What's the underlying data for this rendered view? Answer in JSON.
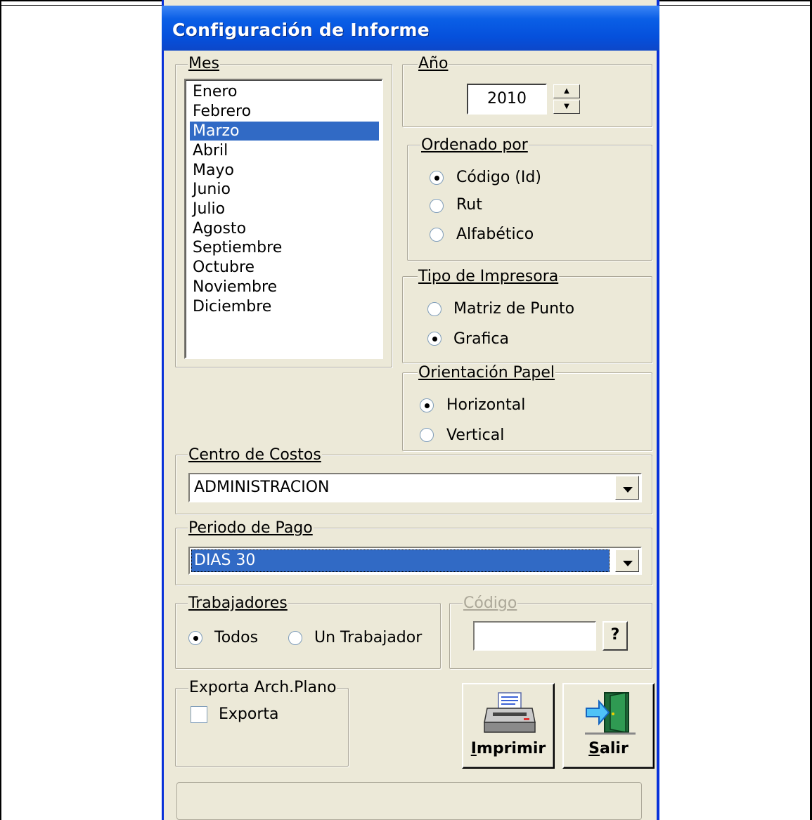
{
  "window": {
    "title": "Configuración de Informe"
  },
  "mes": {
    "legend": "Mes",
    "months": [
      "Enero",
      "Febrero",
      "Marzo",
      "Abril",
      "Mayo",
      "Junio",
      "Julio",
      "Agosto",
      "Septiembre",
      "Octubre",
      "Noviembre",
      "Diciembre"
    ],
    "selected": "Marzo"
  },
  "anio": {
    "legend": "Año",
    "value": "2010"
  },
  "ordenado": {
    "legend": "Ordenado por",
    "options": [
      "Código (Id)",
      "Rut",
      "Alfabético"
    ],
    "selected": "Código (Id)"
  },
  "impresora": {
    "legend": "Tipo de Impresora",
    "options": [
      "Matriz de Punto",
      "Grafica"
    ],
    "selected": "Grafica"
  },
  "orientacion": {
    "legend": "Orientación Papel",
    "options": [
      "Horizontal",
      "Vertical"
    ],
    "selected": "Horizontal"
  },
  "centro": {
    "legend": "Centro de Costos",
    "value": "ADMINISTRACION"
  },
  "periodo": {
    "legend": "Periodo de Pago",
    "value": "DIAS 30"
  },
  "trabajadores": {
    "legend": "Trabajadores",
    "options": [
      "Todos",
      "Un Trabajador"
    ],
    "selected": "Todos"
  },
  "codigo": {
    "legend": "Código",
    "value": "",
    "lookup_label": "?"
  },
  "exporta": {
    "legend": "Exporta Arch.Plano",
    "checkbox_label": "Exporta",
    "checked": false
  },
  "buttons": {
    "imprimir_mn": "I",
    "imprimir_rest": "mprimir",
    "salir_mn": "S",
    "salir_rest": "alir"
  },
  "colors": {
    "title_bar": "#0a5fe6",
    "dialog_bg": "#ece9d8",
    "selection": "#316ac5"
  }
}
